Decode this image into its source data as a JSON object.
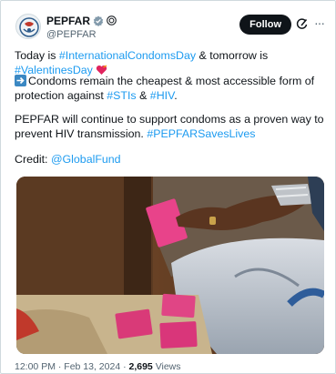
{
  "author": {
    "display_name": "PEPFAR",
    "handle": "@PEPFAR",
    "avatar": "avatar-icon",
    "verified": "verified-badge-icon",
    "gov_badge": "gov-affiliate-icon"
  },
  "header": {
    "follow_label": "Follow",
    "grok_icon": "grok-icon",
    "more_icon": "more-icon"
  },
  "tweet": {
    "p1_pre": "Today is ",
    "p1_tag1": "#InternationalCondomsDay",
    "p1_mid": " & tomorrow is ",
    "p1_tag2": "#ValentinesDay",
    "p2_text": "Condoms remain the cheapest & most accessible form of protection against ",
    "p2_tag1": "#STIs",
    "p2_mid": " & ",
    "p2_tag2": "#HIV",
    "p2_end": ".",
    "p3_text": "PEPFAR will continue to support condoms as a proven way to prevent HIV transmission.   ",
    "p3_tag": "#PEPFARSavesLives",
    "p4_pre": "Credit: ",
    "p4_mention": "@GlobalFund"
  },
  "meta": {
    "time": "12:00 PM · Feb 13, 2024 · ",
    "views_count": "2,695",
    "views_label": " Views"
  },
  "colors": {
    "link": "#1d9bf0",
    "follow_bg": "#0f1419"
  }
}
